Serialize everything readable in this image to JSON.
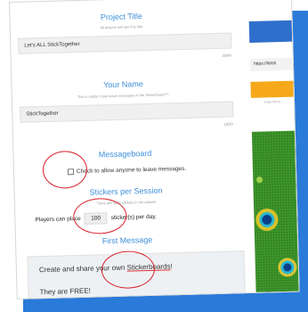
{
  "project_title": {
    "heading": "Project Title",
    "hint": "All players will see this title.",
    "value": "Let's ALL StickTogether",
    "counter": "23/30"
  },
  "your_name": {
    "heading": "Your Name",
    "hint": "This is visible if you leave messages in the Stickerboard™.",
    "value": "StickTogether",
    "counter": "13/20"
  },
  "messageboard": {
    "heading": "Messageboard",
    "checkbox_label": "Check to allow anyone to leave messages.",
    "checked": false
  },
  "stickers_per_session": {
    "heading": "Stickers per Session",
    "hint": "There are 3996 stickers in the artwork",
    "prefix": "Players can place",
    "value": "100",
    "suffix": "sticker(s) per day."
  },
  "first_message": {
    "heading": "First Message",
    "line1_before": "Create and share your own ",
    "line1_link": "Stickerboards",
    "line1_after": "!",
    "line2": "They are FREE!"
  },
  "side_panel": {
    "url_text": "https://letsti",
    "copy_hint": "Copy this le"
  },
  "colors": {
    "accent_title": "#3d8ed9",
    "primary_button": "#2f6fcc",
    "orange_button": "#f4a81a",
    "annotation_circle": "#d81e2a",
    "frame_shadow": "#2a7ad9"
  }
}
